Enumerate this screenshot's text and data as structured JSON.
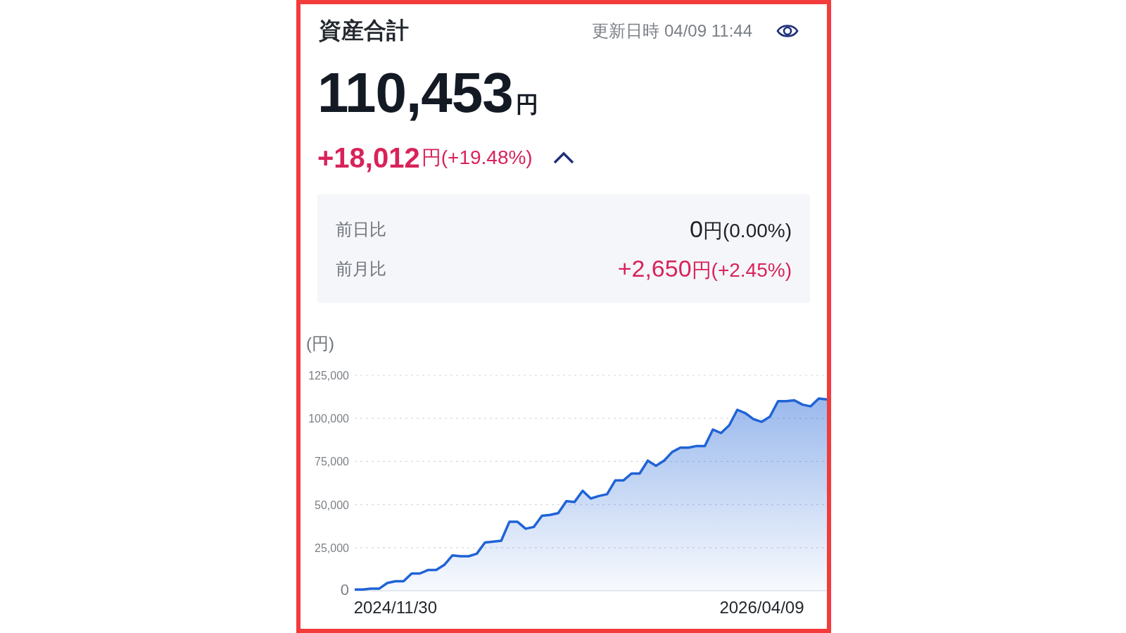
{
  "header": {
    "title": "資産合計",
    "updated": "更新日時 04/09 11:44"
  },
  "total": {
    "amount": "110,453",
    "unit": "円"
  },
  "change": {
    "amount": "+18,012",
    "unit": "円",
    "percent": "(+19.48%)",
    "expanded": true
  },
  "comparisons": [
    {
      "label": "前日比",
      "amount": "0",
      "unit": "円",
      "percent": "(0.00%)",
      "color": "#1c1f24"
    },
    {
      "label": "前月比",
      "amount": "+2,650",
      "unit": "円",
      "percent": "(+2.45%)",
      "color": "#d8235a"
    }
  ],
  "chart": {
    "unit_label": "(円)",
    "chart_data": {
      "type": "area",
      "grid": true,
      "ylim": [
        0,
        125000
      ],
      "yticks": [
        {
          "value": 0,
          "label": "0"
        },
        {
          "value": 25000,
          "label": "25,000"
        },
        {
          "value": 50000,
          "label": "50,000"
        },
        {
          "value": 75000,
          "label": "75,000"
        },
        {
          "value": 100000,
          "label": "100,000"
        },
        {
          "value": 125000,
          "label": "125,000"
        }
      ],
      "categories": [
        null,
        null,
        null,
        null,
        null,
        "2024/11/30",
        null,
        null,
        null,
        null,
        null,
        null,
        null,
        null,
        null,
        null,
        null,
        null,
        null,
        null,
        null,
        null,
        null,
        null,
        null,
        null,
        null,
        null,
        null,
        null,
        null,
        null,
        null,
        null,
        null,
        null,
        null,
        null,
        null,
        null,
        null,
        null,
        null,
        null,
        null,
        null,
        null,
        null,
        null,
        null,
        "2026/04/09",
        null,
        null,
        null,
        null,
        null,
        null,
        null,
        null
      ],
      "series": [
        {
          "color": "#1f63d6",
          "values": [
            700,
            700,
            1200,
            1200,
            4500,
            5500,
            5500,
            10000,
            10000,
            12000,
            12000,
            15000,
            20500,
            20000,
            20000,
            21500,
            28000,
            28500,
            29000,
            40000,
            40000,
            36000,
            37000,
            43500,
            44000,
            45000,
            52000,
            51500,
            58000,
            53500,
            55000,
            56000,
            64000,
            64000,
            68000,
            68000,
            75500,
            72500,
            75500,
            80500,
            83000,
            83000,
            84000,
            84000,
            93500,
            91500,
            96000,
            105000,
            103000,
            99500,
            98000,
            101000,
            110000,
            110000,
            110500,
            108000,
            107000,
            111500,
            111000
          ]
        }
      ]
    }
  }
}
